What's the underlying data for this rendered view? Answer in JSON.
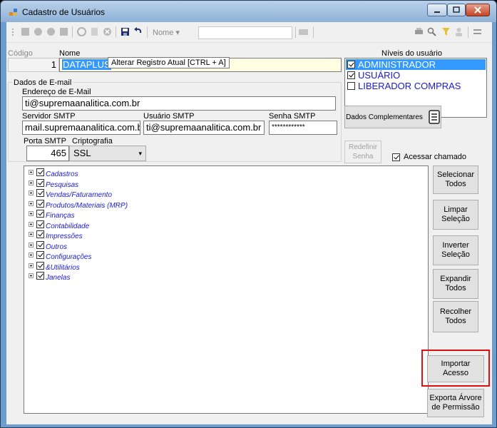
{
  "window": {
    "title": "Cadastro de Usuários"
  },
  "toolbar": {
    "nome_label": "Nome"
  },
  "form": {
    "codigo_label": "Código",
    "codigo_value": "1",
    "nome_label": "Nome",
    "nome_value": "DATAPLUS",
    "tooltip": "Alterar Registro Atual [CTRL + A]",
    "email_group_label": "Dados de E-mail",
    "email_label": "Endereço de E-Mail",
    "email_value": "ti@supremaanalitica.com.br",
    "smtp_server_label": "Servidor SMTP",
    "smtp_server_value": "mail.supremaanalitica.com.br",
    "smtp_user_label": "Usuário SMTP",
    "smtp_user_value": "ti@supremaanalitica.com.br",
    "smtp_pass_label": "Senha SMTP",
    "smtp_pass_value": "************",
    "smtp_port_label": "Porta SMTP",
    "smtp_port_value": "465",
    "crypto_label": "Criptografia",
    "crypto_value": "SSL"
  },
  "levels": {
    "title": "Níveis do usuário",
    "items": [
      {
        "label": "ADMINISTRADOR",
        "checked": true,
        "selected": true
      },
      {
        "label": "USUÁRIO",
        "checked": true,
        "selected": false
      },
      {
        "label": "LIBERADOR COMPRAS",
        "checked": false,
        "selected": false
      }
    ]
  },
  "buttons": {
    "dados_complementares": "Dados Complementares",
    "redefinir_senha": "Redefinir Senha",
    "acessar_chamado": "Acessar chamado",
    "selecionar_todos": "Selecionar Todos",
    "limpar_selecao": "Limpar Seleção",
    "inverter_selecao": "Inverter Seleção",
    "expandir_todos": "Expandir Todos",
    "recolher_todos": "Recolher Todos",
    "importar_acesso": "Importar Acesso",
    "exporta_arvore": "Exporta Árvore de Permissão"
  },
  "tree": [
    "Cadastros",
    "Pesquisas",
    "Vendas/Faturamento",
    "Produtos/Materiais (MRP)",
    "Finanças",
    "Contabilidade",
    "Impressões",
    "Outros",
    "Configurações",
    "&Utilitários",
    "Janelas"
  ],
  "colors": {
    "highlight": "#e01010",
    "tree_text": "#1a1ad0",
    "selection": "#3399ff"
  }
}
